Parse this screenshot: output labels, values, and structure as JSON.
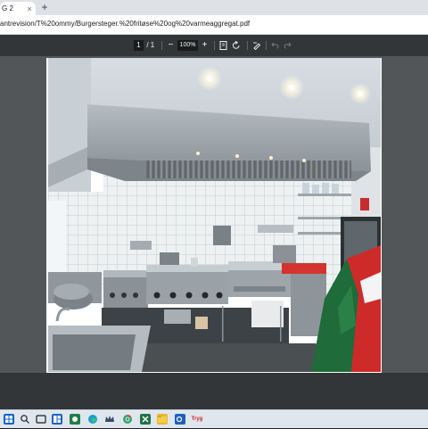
{
  "browser": {
    "tab_title": "G 2",
    "tab_close": "×",
    "new_tab": "+",
    "url": "antrevision/T%20ommy/Burgersteger.%20fritøse%20og%20varmeaggregat.pdf"
  },
  "pdf_toolbar": {
    "current_page": "1",
    "page_separator": "/",
    "total_pages": "1",
    "zoom_out": "−",
    "zoom_level": "100%",
    "zoom_in": "+"
  },
  "document": {
    "content": "photo of commercial kitchen with stainless steel extraction hood, griddles and fryer"
  },
  "taskbar": {
    "icons": [
      "windows-start",
      "search",
      "task-view",
      "widgets",
      "file-explorer",
      "edge",
      "chrome",
      "crown-app",
      "excel",
      "word",
      "outlook",
      "tryg"
    ],
    "tryg_label": "Tryg"
  },
  "colors": {
    "toolbar": "#323639",
    "viewer_bg": "#525659",
    "tab_strip": "#dee1e6",
    "taskbar": "#dfe6ee"
  }
}
